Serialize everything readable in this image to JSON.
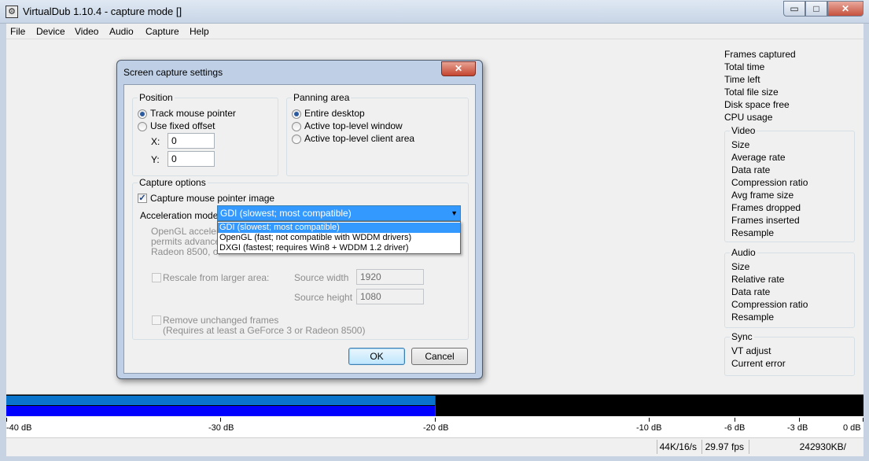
{
  "window": {
    "title": "VirtualDub 1.10.4 - capture mode []",
    "icon": "filmstrip-gear-icon"
  },
  "window_controls": {
    "minimize": "▭",
    "maximize": "□",
    "close": "✕"
  },
  "menu": [
    "File",
    "Device",
    "Video",
    "Audio",
    "Capture",
    "Help"
  ],
  "stats": {
    "top": [
      "Frames captured",
      "Total time",
      "Time left",
      "Total file size",
      "Disk space free",
      "CPU usage"
    ],
    "video": {
      "title": "Video",
      "items": [
        "Size",
        "Average rate",
        "Data rate",
        "Compression ratio",
        "Avg frame size",
        "Frames dropped",
        "Frames inserted",
        "Resample"
      ]
    },
    "audio": {
      "title": "Audio",
      "items": [
        "Size",
        "Relative rate",
        "Data rate",
        "Compression ratio",
        "Resample"
      ]
    },
    "sync": {
      "title": "Sync",
      "items": [
        "VT adjust",
        "Current error"
      ]
    }
  },
  "meter": {
    "level_fraction": 0.5,
    "peak_fraction": 0.5,
    "colors": {
      "bar_top": "#0a74cc",
      "bar_bottom": "#0000ff",
      "peak": "#dd0000",
      "background": "#000000"
    },
    "scale": [
      "-40 dB",
      "-30 dB",
      "-20 dB",
      "-10 dB",
      "-6 dB",
      "-3 dB",
      "0 dB"
    ]
  },
  "statusbar": {
    "audio_format": "44K/16/s",
    "fps": "29.97 fps",
    "disk": "242930KB/"
  },
  "dialog": {
    "title": "Screen capture settings",
    "close": "✕",
    "position": {
      "title": "Position",
      "track_label": "Track mouse pointer",
      "track_selected": true,
      "fixed_label": "Use fixed offset",
      "x_label": "X:",
      "x_value": "0",
      "y_label": "Y:",
      "y_value": "0"
    },
    "panning": {
      "title": "Panning area",
      "options": [
        "Entire desktop",
        "Active top-level window",
        "Active top-level client area"
      ],
      "selected_index": 0
    },
    "capture_options": {
      "title": "Capture options",
      "capture_pointer_label": "Capture mouse pointer image",
      "capture_pointer_checked": true,
      "accel_label": "Acceleration mode",
      "accel_value": "GDI (slowest; most compatible)",
      "accel_options": [
        "GDI (slowest; most compatible)",
        "OpenGL (fast; not compatible with WDDM drivers)",
        "DXGI (fastest; requires Win8 + WDDM 1.2 driver)"
      ],
      "note_lines": [
        "OpenGL accelerat",
        "permits advanced",
        "Radeon 8500, or"
      ],
      "rescale_label": "Rescale from larger area:",
      "source_width_label": "Source width",
      "source_width_value": "1920",
      "source_height_label": "Source height",
      "source_height_value": "1080",
      "remove_label": "Remove unchanged frames",
      "remove_note": "(Requires at least a GeForce 3 or Radeon 8500)"
    },
    "ok": "OK",
    "cancel": "Cancel"
  }
}
